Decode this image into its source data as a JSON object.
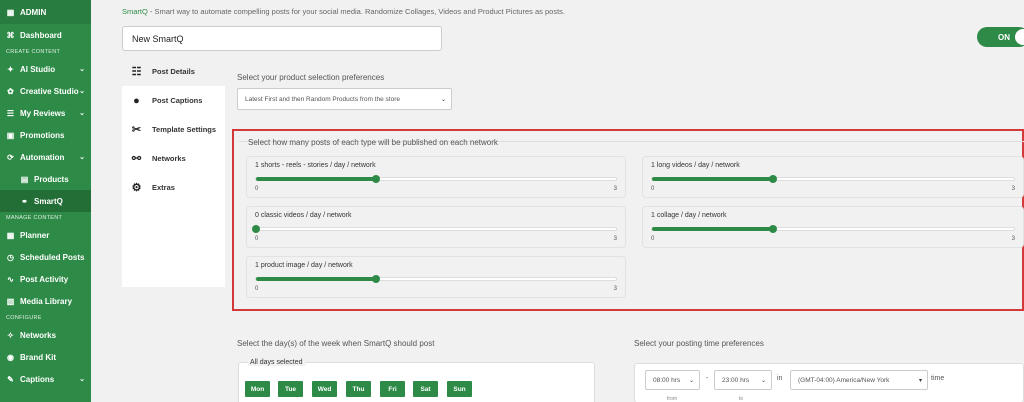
{
  "sidebar": {
    "admin": "ADMIN",
    "dashboard": "Dashboard",
    "section_create": "CREATE CONTENT",
    "ai_studio": "AI Studio",
    "creative_studio": "Creative Studio",
    "my_reviews": "My Reviews",
    "promotions": "Promotions",
    "automation": "Automation",
    "products": "Products",
    "smartq": "SmartQ",
    "section_manage": "MANAGE CONTENT",
    "planner": "Planner",
    "scheduled_posts": "Scheduled Posts",
    "post_activity": "Post Activity",
    "media_library": "Media Library",
    "section_configure": "CONFIGURE",
    "networks": "Networks",
    "brand_kit": "Brand Kit",
    "captions": "Captions"
  },
  "header": {
    "brand": "SmartQ",
    "intro_rest": " - Smart way to automate compelling posts for your social media. Randomize Collages, Videos and Product Pictures as posts.",
    "name_value": "New SmartQ",
    "toggle_label": "ON"
  },
  "tabs": [
    {
      "label": "Post Details",
      "icon": "sliders-icon"
    },
    {
      "label": "Post Captions",
      "icon": "speech-bubble-icon"
    },
    {
      "label": "Template Settings",
      "icon": "tools-icon"
    },
    {
      "label": "Networks",
      "icon": "network-icon"
    },
    {
      "label": "Extras",
      "icon": "gear-icon"
    }
  ],
  "main": {
    "product_pref_label": "Select your product selection preferences",
    "product_pref_value": "Latest First and then Random Products from the store",
    "posts_group_title": "Select how many posts of each type will be published on each network",
    "sliders": [
      {
        "label": "1 shorts - reels - stories / day / network",
        "value": 1,
        "min": "0",
        "max": "3"
      },
      {
        "label": "1 long videos / day / network",
        "value": 1,
        "min": "0",
        "max": "3"
      },
      {
        "label": "0 classic videos / day / network",
        "value": 0,
        "min": "0",
        "max": "3"
      },
      {
        "label": "1 collage / day / network",
        "value": 1,
        "min": "0",
        "max": "3"
      },
      {
        "label": "1 product image / day / network",
        "value": 1,
        "min": "0",
        "max": "3"
      }
    ],
    "days_label": "Select the day(s) of the week when SmartQ should post",
    "all_days": "All days selected",
    "days": [
      "Mon",
      "Tue",
      "Wed",
      "Thu",
      "Fri",
      "Sat",
      "Sun"
    ],
    "time_label": "Select your posting time preferences",
    "time_from": "08:00 hrs",
    "time_dash": "-",
    "time_to": "23:00 hrs",
    "time_in": "in",
    "timezone": "(GMT-04:00) America/New York",
    "time_word": "time",
    "from_caption": "from",
    "to_caption": "to"
  },
  "colors": {
    "accent": "#2e8b47",
    "highlight": "#d33a3a"
  }
}
